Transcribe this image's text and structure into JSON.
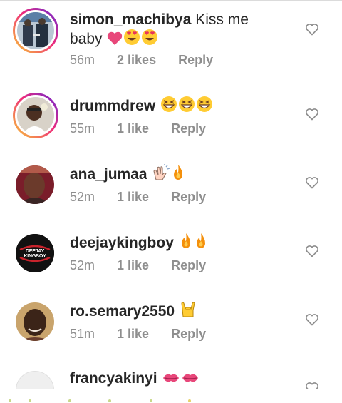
{
  "comments": [
    {
      "username": "simon_machibya",
      "text_part1": " Kiss me",
      "text_part2": "baby",
      "time": "56m",
      "likes": "2 likes",
      "reply": "Reply",
      "avatar": "photo-two-people",
      "emoji": [
        "pink-heart-icon",
        "smiling-face-with-heart-eyes-icon",
        "smiling-face-with-heart-eyes-icon"
      ]
    },
    {
      "username": "drummdrew",
      "time": "55m",
      "likes": "1 like",
      "reply": "Reply",
      "avatar": "photo-person-selfie",
      "emoji": [
        "grinning-squinting-face-icon",
        "grinning-squinting-face-icon",
        "grinning-squinting-face-icon"
      ]
    },
    {
      "username": "ana_jumaa",
      "time": "52m",
      "likes": "1 like",
      "reply": "Reply",
      "avatar": "photo-woman",
      "emoji": [
        "clapping-hands-icon",
        "fire-icon"
      ]
    },
    {
      "username": "deejaykingboy",
      "time": "52m",
      "likes": "1 like",
      "reply": "Reply",
      "avatar": "logo-deejay-kingboy",
      "avatar_text": "DEEJAY KINGBOY",
      "emoji": [
        "fire-icon",
        "fire-icon"
      ]
    },
    {
      "username": "ro.semary2550",
      "time": "51m",
      "likes": "1 like",
      "reply": "Reply",
      "avatar": "photo-woman-smiling",
      "emoji": [
        "sign-of-the-horns-icon"
      ]
    },
    {
      "username": "francyakinyi",
      "avatar": "empty",
      "emoji": [
        "kiss-mark-icon",
        "kiss-mark-icon"
      ]
    }
  ],
  "colors": {
    "text": "#262626",
    "meta": "#8e8e8e",
    "story_ring_start": "#f9ce34",
    "story_ring_end": "#6228d7",
    "emoji_yellow": "#ffcc33",
    "emoji_pink": "#e8477a",
    "fire_orange": "#f4900c"
  }
}
